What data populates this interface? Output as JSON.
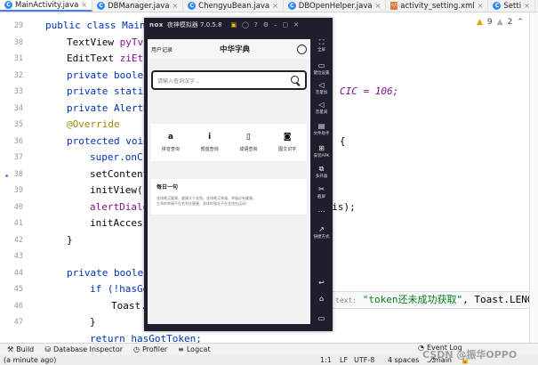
{
  "tabs": [
    {
      "label": "MainActivity.java",
      "icon": "java-class-icon",
      "active": true
    },
    {
      "label": "DBManager.java",
      "icon": "java-class-icon"
    },
    {
      "label": "ChengyuBean.java",
      "icon": "java-class-icon"
    },
    {
      "label": "DBOpenHelper.java",
      "icon": "java-class-icon"
    },
    {
      "label": "activity_setting.xml",
      "icon": "xml-file-icon"
    },
    {
      "label": "Setti",
      "icon": "java-class-icon"
    }
  ],
  "editor": {
    "warnings": "9",
    "weak_warnings": "2",
    "line_numbers": [
      "29",
      "30",
      "31",
      "32",
      "33",
      "34",
      "35",
      "36",
      "37",
      "38",
      "39",
      "40",
      "41",
      "42",
      "43",
      "44",
      "45",
      "46",
      "47"
    ],
    "lines": [
      [
        [
          "public class MainA",
          "kw"
        ]
      ],
      [
        [
          "TextView ",
          ""
        ],
        [
          "pyTv,",
          "fld"
        ]
      ],
      [
        [
          "EditText ",
          ""
        ],
        [
          "ziEt;",
          "fld"
        ]
      ],
      [
        [
          "private boolea",
          "kw"
        ]
      ],
      [
        [
          "private static",
          "kw"
        ],
        [
          "",
          ""
        ]
      ],
      [
        [
          "private AlertD",
          "kw"
        ]
      ],
      [
        [
          "@Override",
          "ann"
        ]
      ],
      [
        [
          "protected void",
          "kw"
        ]
      ],
      [
        [
          "super.onCr",
          "kw"
        ]
      ],
      [
        [
          "setContent",
          ""
        ]
      ],
      [
        [
          "initView()",
          ""
        ]
      ],
      [
        [
          "alertDialo",
          "fld"
        ]
      ],
      [
        [
          "initAccess",
          ""
        ]
      ],
      [
        [
          "}",
          ""
        ]
      ],
      [
        [
          "",
          ""
        ]
      ],
      [
        [
          "private boolea",
          "kw"
        ]
      ],
      [
        [
          "if (!hasGo",
          "kw"
        ]
      ],
      [
        [
          "Toast.",
          ""
        ]
      ],
      [
        [
          "}",
          ""
        ]
      ],
      [
        [
          "return hasGotToken;",
          "kw"
        ]
      ]
    ],
    "right_fragments": {
      "l33": "CIC = 106;",
      "l36": "e) {",
      "l40": "this);",
      "l29": "t"
    },
    "hint_prefix": "text:",
    "hint_string": "\"token还未成功获取\"",
    "hint_rest": ", Toast.LENGTH_L"
  },
  "emulator": {
    "title": "夜神模拟器 7.0.5.8",
    "logo": "nox",
    "app": {
      "left_label": "用户记录",
      "title": "中华字典",
      "search_placeholder": "请输入查询汉字...",
      "functions": [
        {
          "icon": "a",
          "label": "拼音查询",
          "name": "pinyin-search"
        },
        {
          "icon": "i",
          "label": "部首查询",
          "name": "radical-search"
        },
        {
          "icon": "▯",
          "label": "成语查询",
          "name": "idiom-search"
        },
        {
          "icon": "◙",
          "label": "图文识字",
          "name": "image-recognition"
        }
      ],
      "daily_title": "每日一句",
      "daily_text_1": "金钱难买健康，健康大于金钱，金钱难买幸福，幸福必有健康。",
      "daily_text_2": "生命的幸福不在名利在健康，身体的强壮不在金钱在运动！"
    },
    "sidebar": [
      {
        "icon": "⛶",
        "label": "全屏"
      },
      {
        "icon": "▭",
        "label": "键位设置"
      },
      {
        "icon": "◁",
        "label": "音量加"
      },
      {
        "icon": "◁",
        "label": "音量减"
      },
      {
        "icon": "▤",
        "label": "文件助手"
      },
      {
        "icon": "⊞",
        "label": "安装APK"
      },
      {
        "icon": "⧉",
        "label": "多开器"
      },
      {
        "icon": "✂",
        "label": "截屏"
      },
      {
        "icon": "⋯",
        "label": ""
      },
      {
        "icon": "↗",
        "label": "快捷方式"
      },
      {
        "icon": "↩",
        "label": ""
      },
      {
        "icon": "⌂",
        "label": ""
      },
      {
        "icon": "▭",
        "label": ""
      }
    ]
  },
  "toolwindows": [
    {
      "label": "Build",
      "icon": "hammer-icon"
    },
    {
      "label": "Database Inspector",
      "icon": "database-icon"
    },
    {
      "label": "Profiler",
      "icon": "profiler-icon"
    },
    {
      "label": "Logcat",
      "icon": "logcat-icon"
    }
  ],
  "bottom": {
    "left": "(a minute ago)",
    "pos": "1:1",
    "lf": "LF",
    "enc": "UTF-8",
    "indent": "4 spaces",
    "branch": "main",
    "event": "Event Log",
    "watermark": "CSDN @振华OPPO"
  }
}
